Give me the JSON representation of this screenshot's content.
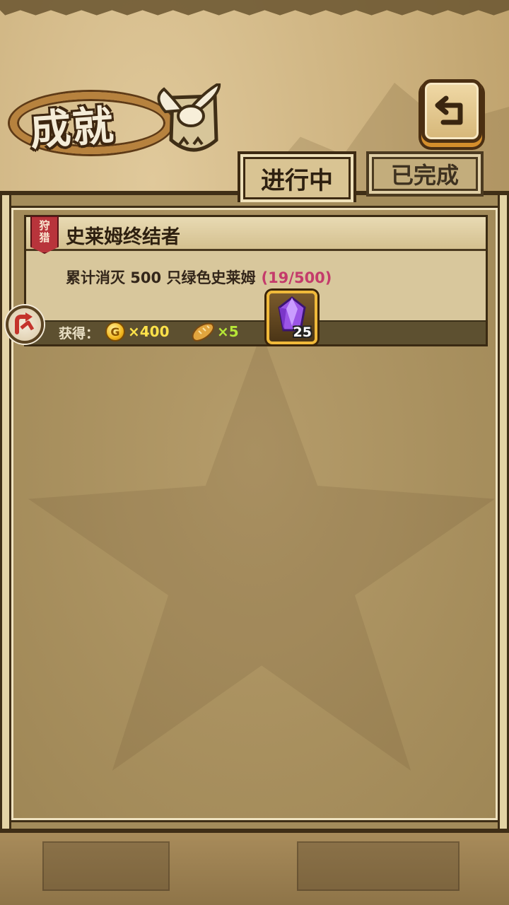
{
  "header": {
    "title": "成就"
  },
  "tabs": [
    {
      "label": "进行中",
      "active": true
    },
    {
      "label": "已完成",
      "active": false
    }
  ],
  "achievements": [
    {
      "category_line1": "狩",
      "category_line2": "猎",
      "title": "史莱姆终结者",
      "description": "累计消灭 500 只绿色史莱姆",
      "progress": "(19/500)",
      "reward_label": "获得：",
      "coin_symbol": "G",
      "coin_amount": "×400",
      "bread_amount": "×5",
      "gem_count": "25"
    }
  ],
  "colors": {
    "progress": "#c43b6b",
    "coin_amount": "#ffe24a",
    "bread_amount": "#b6e637",
    "category_tag": "#b8343b"
  },
  "icons": [
    "back-arrow-icon",
    "coin-icon",
    "bread-icon",
    "gem-icon",
    "go-arrow-icon",
    "winged-emblem-icon"
  ]
}
